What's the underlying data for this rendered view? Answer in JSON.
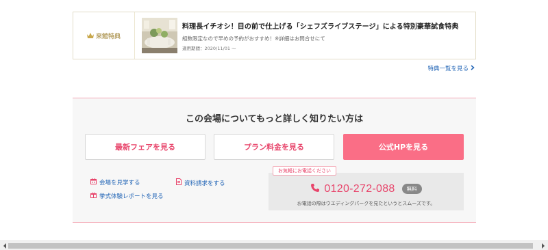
{
  "benefit": {
    "tag_label": "来館特典",
    "title": "料理長イチオシ！目の前で仕上げる「シェフズライブステージ」による特別豪華試食特典",
    "description": "組数限定なので早めの予約がおすすめ！※詳細はお問合せにて",
    "period": "適用期間：2020/11/01 ～",
    "list_link": "特典一覧を見る"
  },
  "info": {
    "heading": "この会場についてもっと詳しく知りたい方は",
    "buttons": {
      "fair": "最新フェアを見る",
      "plan": "プラン料金を見る",
      "official": "公式HPを見る"
    },
    "links": {
      "visit": "会場を見学する",
      "docs": "資料請求をする",
      "report": "挙式体験レポートを見る"
    },
    "phone": {
      "pill": "お気軽にお電話ください",
      "number": "0120-272-088",
      "free_badge": "無料",
      "note": "お電話の際はウエディングパークを見たというとスムーズです。"
    }
  },
  "colors": {
    "accent_pink": "#fa6e86",
    "text_pink": "#e8456b",
    "link_blue": "#1f63b5",
    "gold": "#b9a46a"
  },
  "icons": [
    "crown-icon",
    "chevron-right-icon",
    "calendar-icon",
    "document-icon",
    "gift-icon",
    "phone-icon",
    "arrow-left-icon",
    "arrow-right-icon"
  ]
}
